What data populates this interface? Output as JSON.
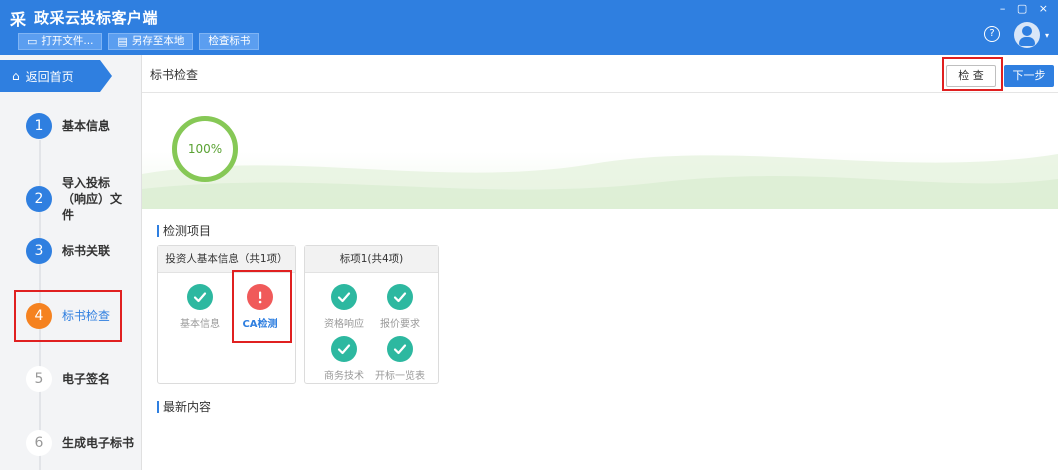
{
  "app": {
    "title": "政采云投标客户端",
    "logo_glyph": "采",
    "window_controls": "– ▢ ×"
  },
  "toolbar": {
    "open_file": "打开文件...",
    "save_local": "另存至本地",
    "check_bid": "检查标书"
  },
  "header": {
    "help_glyph": "?",
    "avatar_caret": "▾"
  },
  "sidebar": {
    "home_label": "返回首页",
    "steps": [
      {
        "num": "1",
        "label": "基本信息",
        "state": "done"
      },
      {
        "num": "2",
        "label": "导入投标（响应）文件",
        "state": "done"
      },
      {
        "num": "3",
        "label": "标书关联",
        "state": "done"
      },
      {
        "num": "4",
        "label": "标书检查",
        "state": "active"
      },
      {
        "num": "5",
        "label": "电子签名",
        "state": "todo"
      },
      {
        "num": "6",
        "label": "生成电子标书",
        "state": "todo"
      }
    ]
  },
  "content": {
    "page_title": "标书检查",
    "check_button": "检 查",
    "next_button": "下一步",
    "progress": "100%",
    "section_items_title": "检测项目",
    "section_latest_title": "最新内容",
    "cards": [
      {
        "title": "投资人基本信息（共1项）",
        "items": [
          {
            "label": "基本信息",
            "status": "ok"
          },
          {
            "label": "CA检测",
            "status": "warn"
          }
        ]
      },
      {
        "title": "标项1(共4项)",
        "items": [
          {
            "label": "资格响应",
            "status": "ok"
          },
          {
            "label": "报价要求",
            "status": "ok"
          },
          {
            "label": "商务技术",
            "status": "ok"
          },
          {
            "label": "开标一览表",
            "status": "ok"
          }
        ]
      }
    ]
  },
  "colors": {
    "brand_blue": "#2f7fe0",
    "active_orange": "#f58220",
    "ok_teal": "#2db8a0",
    "warn_red": "#f05a5a",
    "progress_green": "#86c856",
    "highlight_red": "#e02020"
  }
}
